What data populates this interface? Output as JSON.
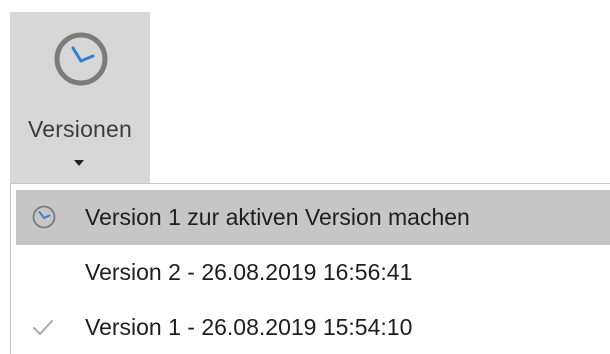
{
  "ribbon": {
    "versions_button": {
      "label": "Versionen",
      "icon": "clock-icon",
      "dropdown_arrow": "dropdown-arrow-icon"
    }
  },
  "menu": {
    "items": [
      {
        "label": "Version 1 zur aktiven Version machen",
        "icon": "clock-icon",
        "highlighted": true
      },
      {
        "label": "Version 2 - 26.08.2019 16:56:41",
        "icon": "",
        "checked": false
      },
      {
        "label": "Version 1 - 26.08.2019 15:54:10",
        "icon": "check-icon",
        "checked": true
      }
    ]
  },
  "colors": {
    "button_pressed_bg": "#d7d7d7",
    "menu_highlight_bg": "#c6c6c6",
    "clock_hands": "#2f7fd4",
    "clock_ring": "#7b7b7b",
    "check_mark": "#a9a9a9"
  }
}
